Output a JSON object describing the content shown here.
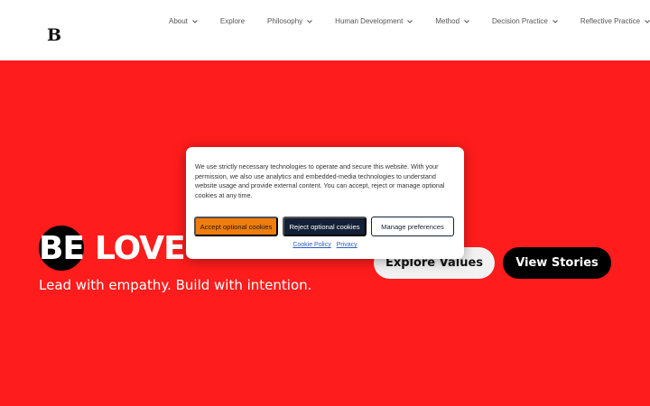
{
  "header": {
    "logo": "B",
    "nav": [
      {
        "label": "About",
        "has_dropdown": true
      },
      {
        "label": "Explore",
        "has_dropdown": false
      },
      {
        "label": "Philosophy",
        "has_dropdown": true
      },
      {
        "label": "Human Development",
        "has_dropdown": true
      },
      {
        "label": "Method",
        "has_dropdown": true
      },
      {
        "label": "Decision Practice",
        "has_dropdown": true
      },
      {
        "label": "Reflective Practice",
        "has_dropdown": true
      }
    ]
  },
  "hero": {
    "brand_be": "BE",
    "brand_love": "LOVE",
    "tagline": "Lead with empathy. Build with intention.",
    "explore_button": "Explore Values",
    "stories_button": "View Stories"
  },
  "cookie_banner": {
    "text": "We use strictly necessary technologies to operate and secure this website. With your permission, we also use analytics and embedded-media technologies to understand website usage and provide external content. You can accept, reject or manage optional cookies at any time.",
    "accept_label": "Accept optional cookies",
    "reject_label": "Reject optional cookies",
    "manage_label": "Manage preferences",
    "policy_link": "Cookie Policy",
    "privacy_link": "Privacy"
  },
  "colors": {
    "hero_background": "#ff1c1c",
    "accept_button": "#f07d0e",
    "reject_button": "#132035",
    "link": "#2b5fbf"
  }
}
